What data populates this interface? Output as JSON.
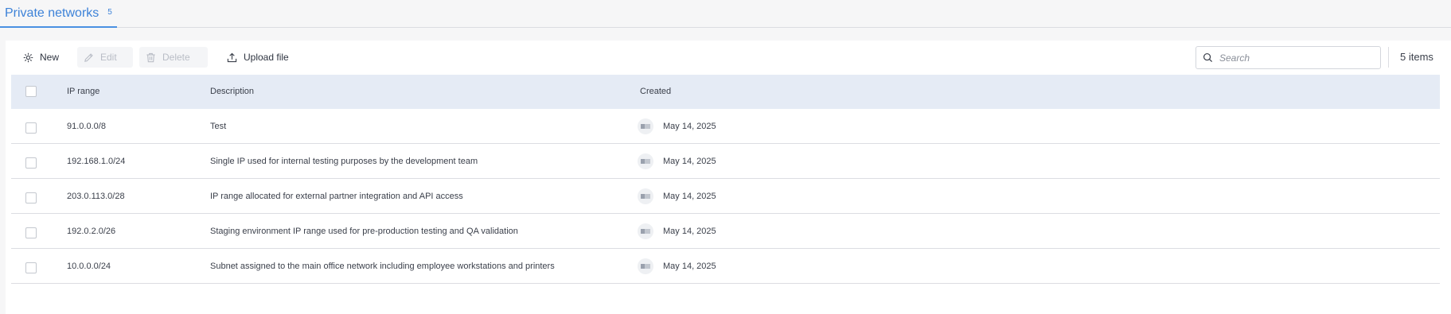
{
  "tab": {
    "label": "Private networks",
    "count": "5"
  },
  "toolbar": {
    "new_label": "New",
    "edit_label": "Edit",
    "delete_label": "Delete",
    "upload_label": "Upload file"
  },
  "search": {
    "placeholder": "Search"
  },
  "items_count": "5 items",
  "columns": {
    "ip": "IP range",
    "description": "Description",
    "created": "Created"
  },
  "rows": [
    {
      "ip": "91.0.0.0/8",
      "description": "Test",
      "created": "May 14, 2025"
    },
    {
      "ip": "192.168.1.0/24",
      "description": "Single IP used for internal testing purposes by the development team",
      "created": "May 14, 2025"
    },
    {
      "ip": "203.0.113.0/28",
      "description": "IP range allocated for external partner integration and API access",
      "created": "May 14, 2025"
    },
    {
      "ip": "192.0.2.0/26",
      "description": "Staging environment IP range used for pre-production testing and QA validation",
      "created": "May 14, 2025"
    },
    {
      "ip": "10.0.0.0/24",
      "description": "Subnet assigned to the main office network including employee workstations and printers",
      "created": "May 14, 2025"
    }
  ],
  "colors": {
    "accent": "#3d82d8",
    "header_bg": "#e5ebf5"
  },
  "icons": [
    "sparkle-icon",
    "pencil-icon",
    "trash-icon",
    "upload-icon",
    "search-icon"
  ]
}
